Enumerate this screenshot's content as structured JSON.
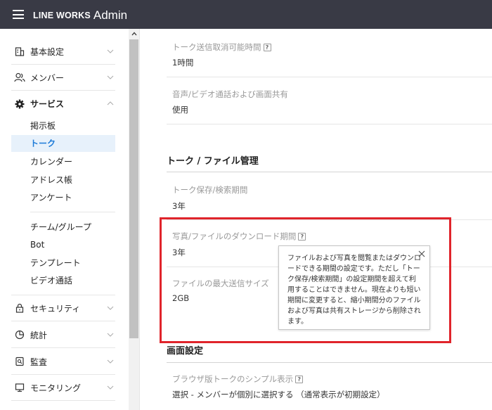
{
  "header": {
    "brand": "LINE WORKS",
    "subtitle": "Admin"
  },
  "sidebar": {
    "groups": [
      {
        "label": "基本設定",
        "icon": "building-icon"
      },
      {
        "label": "メンバー",
        "icon": "members-icon"
      },
      {
        "label": "サービス",
        "icon": "gear-icon"
      }
    ],
    "service_items": [
      "掲示板",
      "トーク",
      "カレンダー",
      "アドレス帳",
      "アンケート"
    ],
    "service_items_2": [
      "チーム/グループ",
      "Bot",
      "テンプレート",
      "ビデオ通話"
    ],
    "groups_bottom": [
      {
        "label": "セキュリティ",
        "icon": "lock-icon"
      },
      {
        "label": "統計",
        "icon": "pie-chart-icon"
      },
      {
        "label": "監査",
        "icon": "audit-icon"
      },
      {
        "label": "モニタリング",
        "icon": "monitor-icon"
      }
    ]
  },
  "main": {
    "talk_cancel": {
      "label": "トーク送信取消可能時間",
      "value": "1時間"
    },
    "voice_video": {
      "label": "音声/ビデオ通話および画面共有",
      "value": "使用"
    },
    "section_title": "トーク / ファイル管理",
    "retention": {
      "label": "トーク保存/検索期間",
      "value": "3年"
    },
    "download_period": {
      "label": "写真/ファイルのダウンロード期間",
      "value": "3年"
    },
    "max_size": {
      "label": "ファイルの最大送信サイズ",
      "value": "2GB"
    },
    "section_title_2": "画面設定",
    "browser_simple": {
      "label": "ブラウザ版トークのシンプル表示",
      "value": "選択 - メンバーが個別に選択する （通常表示が初期設定）"
    },
    "help_glyph": "?"
  },
  "tooltip": {
    "text": "ファイルおよび写真を閲覧またはダウンロードできる期間の設定です。ただし「トーク保存/検索期間」の設定期間を超えて利用することはできません。現在よりも短い期間に変更すると、縮小期間分のファイルおよび写真は共有ストレージから削除されます。"
  },
  "colors": {
    "header_bg": "#393a45",
    "active_bg": "#e7f1fb",
    "active_text": "#1d7bd8",
    "highlight": "#e0242b"
  }
}
